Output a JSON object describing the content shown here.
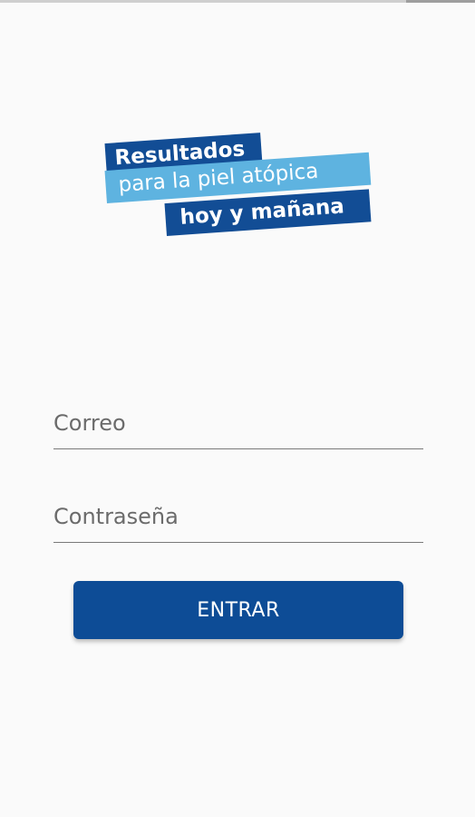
{
  "logo": {
    "line1": "Resultados",
    "line2": "para la piel atópica",
    "line3": "hoy y mañana"
  },
  "form": {
    "email_placeholder": "Correo",
    "email_value": "",
    "password_placeholder": "Contraseña",
    "password_value": "",
    "submit_label": "ENTRAR"
  },
  "colors": {
    "brand_dark_blue": "#0d4c96",
    "brand_light_blue": "#5eb3e0",
    "background": "#fafafa"
  }
}
